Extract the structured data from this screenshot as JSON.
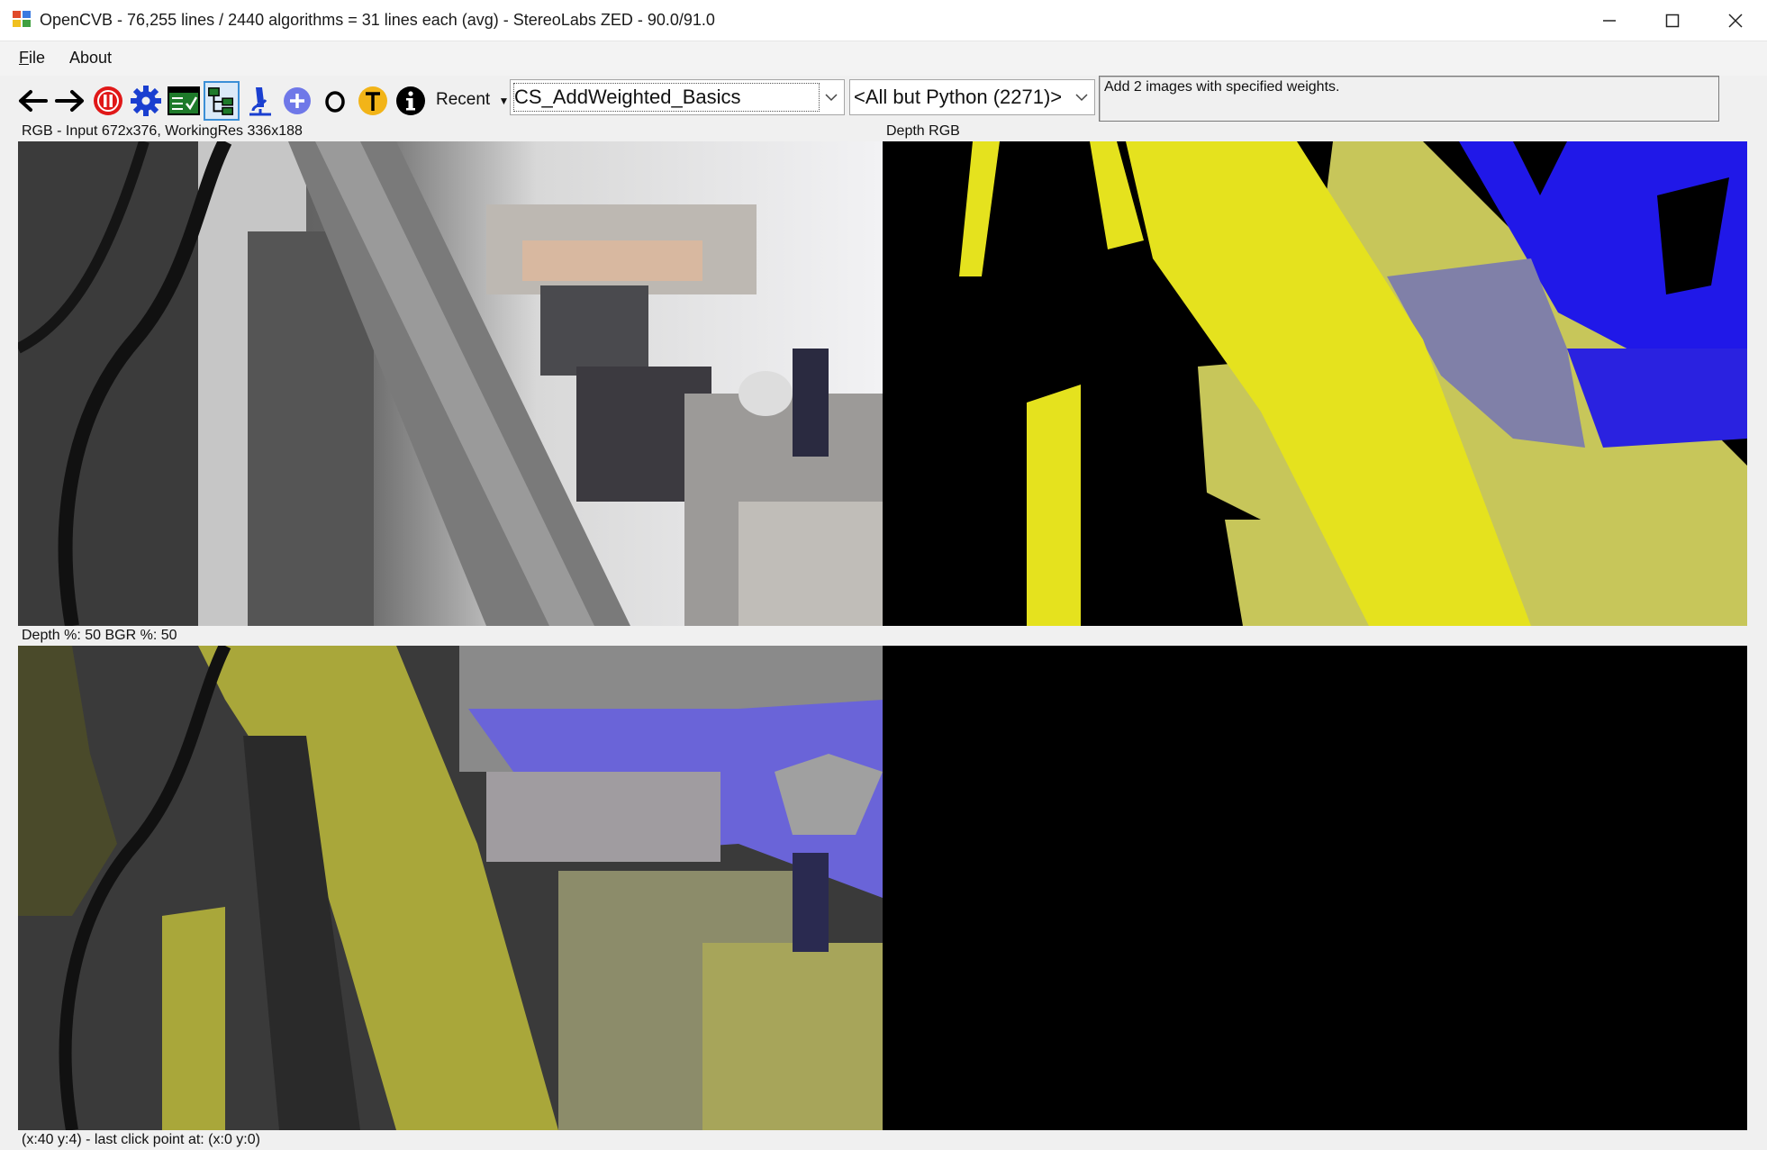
{
  "window": {
    "title": "OpenCVB - 76,255 lines / 2440 algorithms = 31 lines each (avg) - StereoLabs ZED - 90.0/91.0",
    "minimize_icon": "minimize-icon",
    "maximize_icon": "maximize-icon",
    "close_icon": "close-icon"
  },
  "menu": {
    "file": "File",
    "about": "About"
  },
  "toolbar": {
    "buttons": [
      {
        "name": "back-arrow-icon"
      },
      {
        "name": "forward-arrow-icon"
      },
      {
        "name": "pause-icon"
      },
      {
        "name": "gear-icon"
      },
      {
        "name": "test-all-icon"
      },
      {
        "name": "tree-view-icon"
      },
      {
        "name": "microscope-icon"
      },
      {
        "name": "plus-icon"
      },
      {
        "name": "circle-o-icon"
      },
      {
        "name": "translator-t-icon"
      },
      {
        "name": "info-icon"
      }
    ],
    "recent_label": "Recent",
    "algorithm_select": "CS_AddWeighted_Basics",
    "group_select": "<All but Python (2271)>",
    "description": "Add 2 images with specified weights."
  },
  "panels": {
    "top_left_label": "RGB - Input 672x376, WorkingRes 336x188",
    "top_right_label": "Depth RGB",
    "bottom_left_label": "Depth %: 50 BGR %: 50",
    "status": "(x:40 y:4) - last click point at: (x:0 y:0)"
  },
  "colors": {
    "depth_yellow": "#e5e21e",
    "depth_blue": "#1c16f0",
    "blend_yellow": "#a9a73a",
    "selected_border": "#3b8fd6"
  }
}
